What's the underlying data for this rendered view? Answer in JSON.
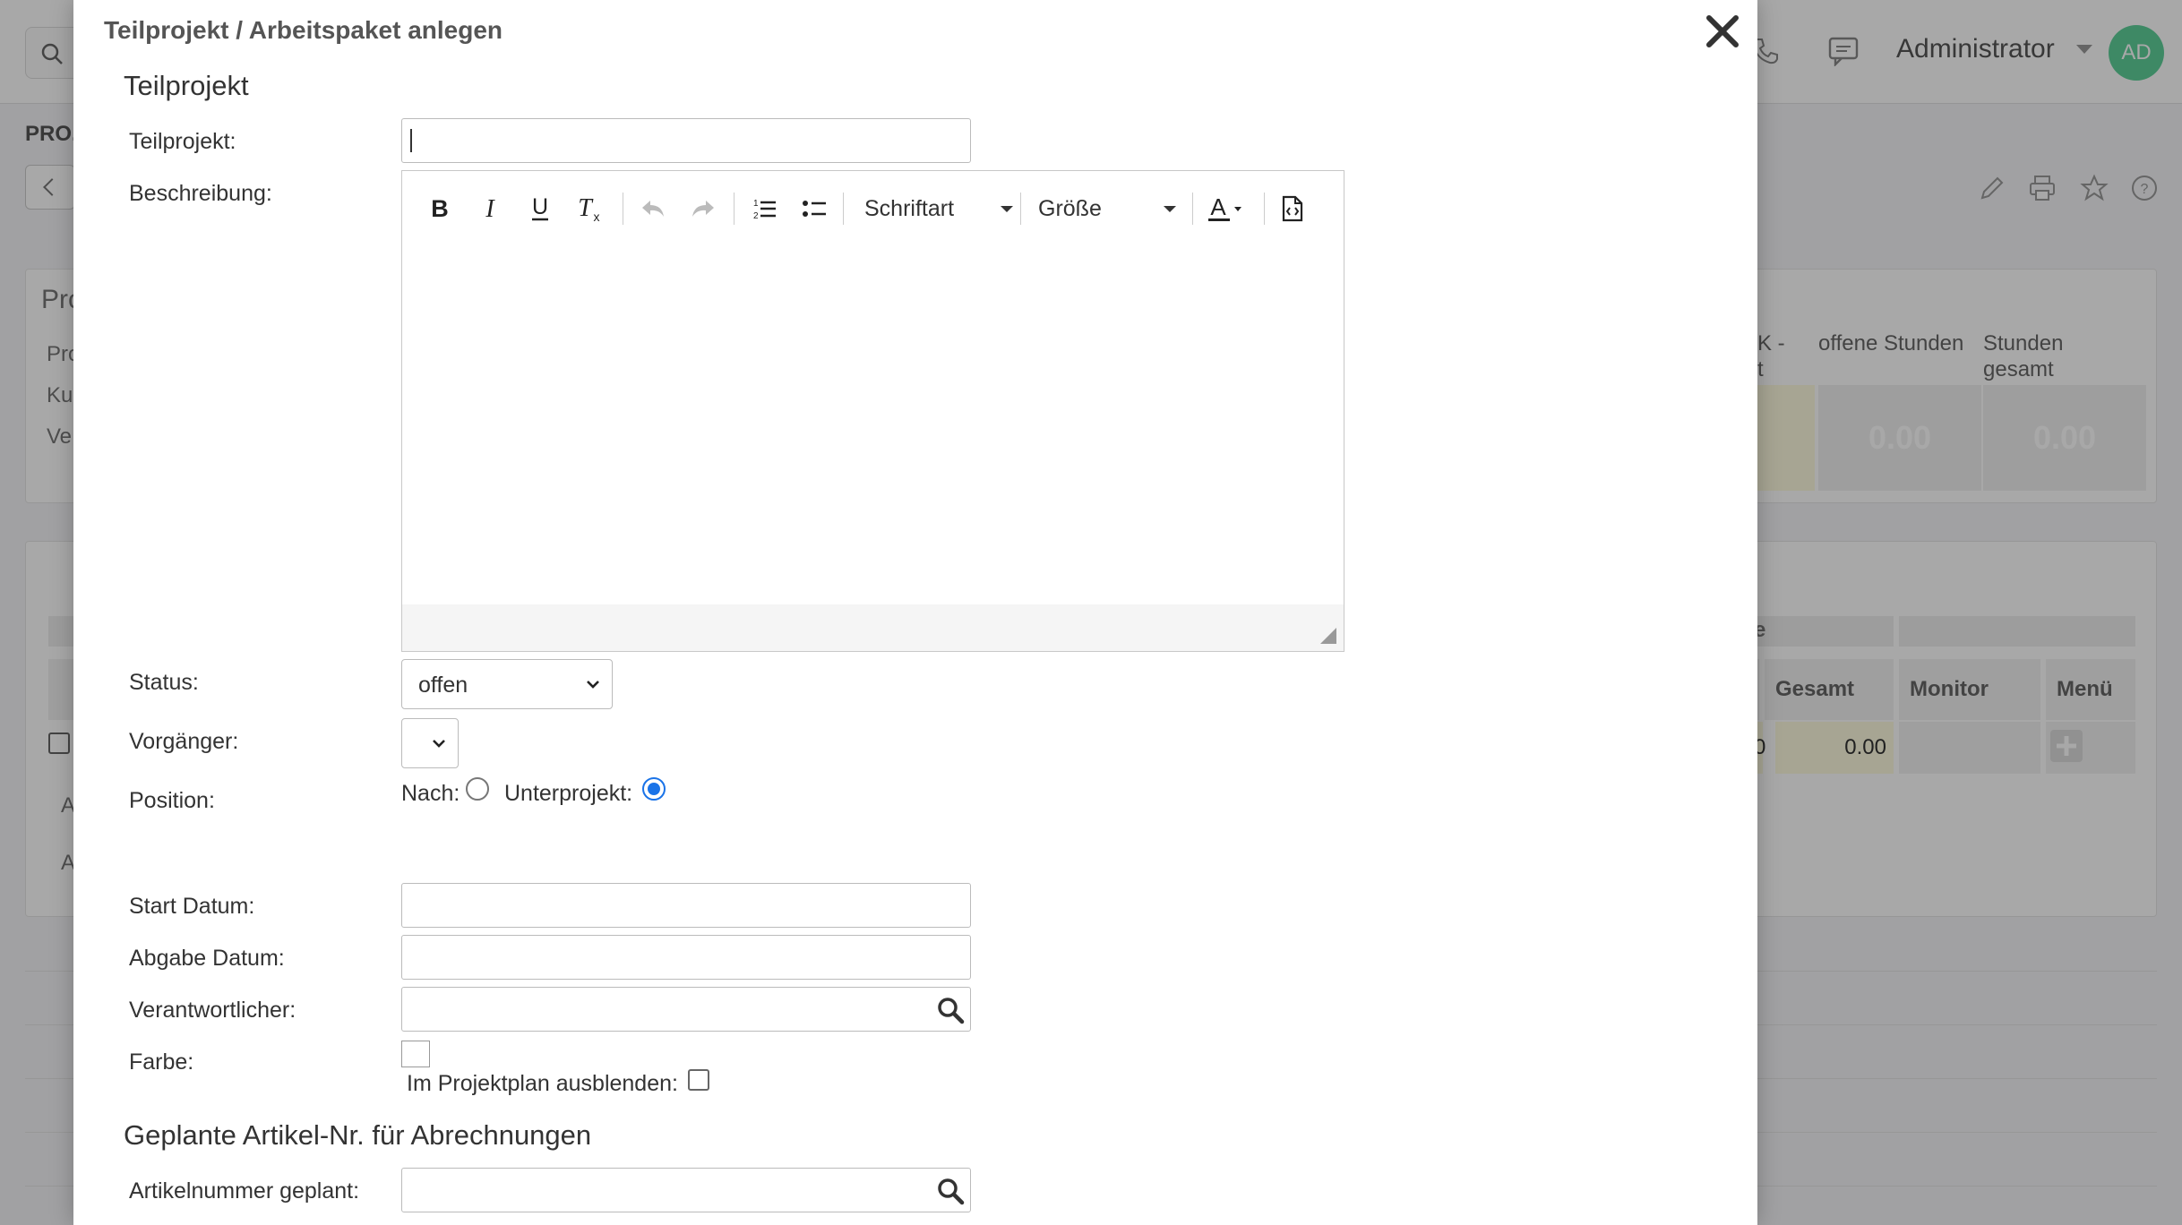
{
  "background": {
    "header": {
      "user_name": "Administrator",
      "avatar_initials": "AD"
    },
    "section_label": "PRO.",
    "panel_title": "Pro",
    "panel_rows": [
      "Pro",
      "Ku",
      "Ve"
    ],
    "columns": {
      "col_a": "K -\nt",
      "col_b": "offene Stunden",
      "col_c": "Stunden\ngesamt"
    },
    "stats": {
      "offene_stunden": "0.00",
      "stunden_gesamt": "0.00"
    },
    "table": {
      "group_header": "e",
      "headers": [
        "Gesamt",
        "Monitor",
        "Menü"
      ],
      "row_values": {
        "left_value": "0",
        "gesamt": "0.00"
      },
      "side_letters": [
        "A",
        "A"
      ]
    },
    "accent_color": "#5fd19a"
  },
  "dialog": {
    "title": "Teilprojekt / Arbeitspaket anlegen",
    "section_teilprojekt": "Teilprojekt",
    "fields": {
      "teilprojekt": {
        "label": "Teilprojekt:",
        "value": ""
      },
      "beschreibung": {
        "label": "Beschreibung:"
      },
      "status": {
        "label": "Status:",
        "value": "offen"
      },
      "vorgaenger": {
        "label": "Vorgänger:",
        "value": ""
      },
      "position": {
        "label": "Position:",
        "nach_label": "Nach:",
        "unterprojekt_label": "Unterprojekt:",
        "selected": "Unterprojekt"
      },
      "start_datum": {
        "label": "Start Datum:",
        "value": ""
      },
      "abgabe_datum": {
        "label": "Abgabe Datum:",
        "value": ""
      },
      "verantwortlicher": {
        "label": "Verantwortlicher:",
        "value": ""
      },
      "farbe": {
        "label": "Farbe:"
      },
      "projektplan": {
        "label": "Im Projektplan ausblenden:",
        "checked": false
      }
    },
    "section_artikel": "Geplante Artikel-Nr. für Abrechnungen",
    "artikel": {
      "label": "Artikelnummer geplant:",
      "value": ""
    },
    "editor_toolbar": {
      "font_combo": "Schriftart",
      "size_combo": "Größe",
      "icons": [
        "bold-icon",
        "italic-icon",
        "underline-icon",
        "remove-format-icon",
        "undo-icon",
        "redo-icon",
        "ordered-list-icon",
        "bullet-list-icon",
        "text-color-icon",
        "source-icon"
      ]
    },
    "selection_color": "#1a73e8"
  }
}
